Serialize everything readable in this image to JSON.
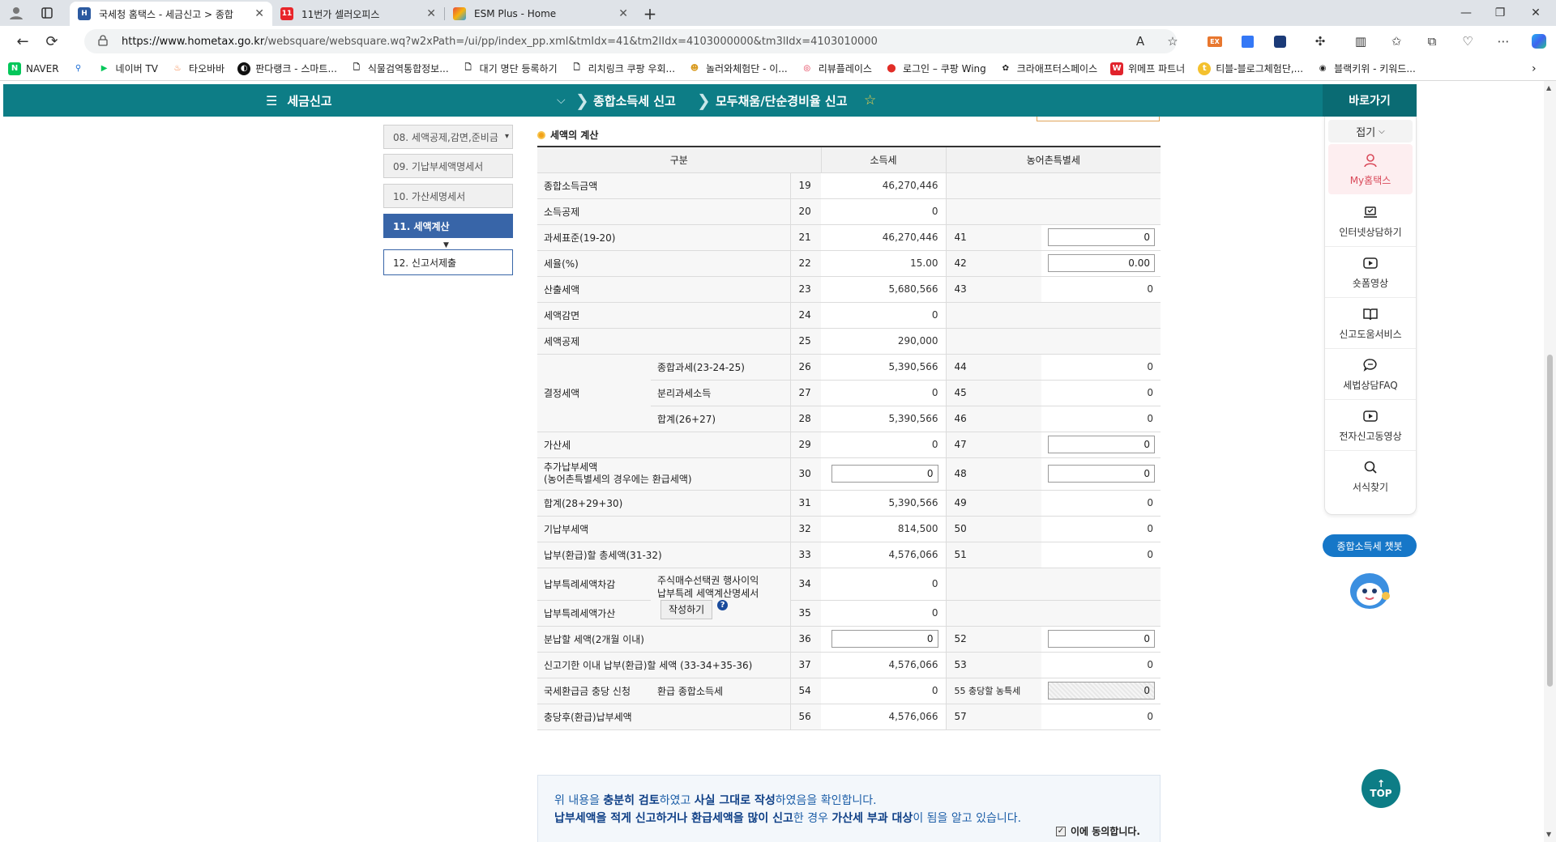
{
  "browser": {
    "tabs": [
      {
        "title": "국세청 홈택스 - 세금신고 > 종합",
        "active": true
      },
      {
        "title": "11번가 셀러오피스",
        "active": false
      },
      {
        "title": "ESM Plus - Home",
        "active": false
      }
    ],
    "url_host": "https://www.hometax.go.kr",
    "url_path": "/websquare/websquare.wq?w2xPath=/ui/pp/index_pp.xml&tmIdx=41&tm2lIdx=4103000000&tm3lIdx=4103010000",
    "bookmarks": [
      "NAVER",
      "네이버 TV",
      "타오바바",
      "판다랭크 - 스마트...",
      "식물검역통합정보...",
      "대기 명단 등록하기",
      "리치링크 쿠팡 우회...",
      "놀러와체험단 - 이...",
      "리뷰플레이스",
      "로그인 – 쿠팡 Wing",
      "크라애프터스페이스",
      "위메프 파트너",
      "티블-블로그체험단,...",
      "블랙키위 - 키워드..."
    ]
  },
  "nav": {
    "menu_label": "세금신고",
    "crumb1": "종합소득세 신고",
    "crumb2": "모두채움/단순경비율 신고",
    "shortcut_title": "바로가기"
  },
  "quick": {
    "fold": "접기",
    "items": [
      "My홈택스",
      "인터넷상담하기",
      "숏폼영상",
      "신고도움서비스",
      "세법상담FAQ",
      "전자신고동영상",
      "서식찾기"
    ],
    "chatbot": "종합소득세 챗봇",
    "top": "TOP"
  },
  "steps": [
    {
      "label": "08. 세액공제,감면,준비금"
    },
    {
      "label": "09. 기납부세액명세서"
    },
    {
      "label": "10. 가산세명세서"
    },
    {
      "label": "11. 세액계산"
    },
    {
      "label": "12. 신고서제출"
    }
  ],
  "section_title": "세액의 계산",
  "table": {
    "headers": [
      "구분",
      "소득세",
      "농어촌특별세"
    ],
    "rows": {
      "r19": {
        "label": "종합소득금액",
        "no": "19",
        "val": "46,270,446"
      },
      "r20": {
        "label": "소득공제",
        "no": "20",
        "val": "0"
      },
      "r21": {
        "label": "과세표준(19-20)",
        "no": "21",
        "val": "46,270,446",
        "no2": "41",
        "val2": "0"
      },
      "r22": {
        "label": "세율(%)",
        "no": "22",
        "val": "15.00",
        "no2": "42",
        "val2": "0.00"
      },
      "r23": {
        "label": "산출세액",
        "no": "23",
        "val": "5,680,566",
        "no2": "43",
        "val2": "0"
      },
      "r24": {
        "label": "세액감면",
        "no": "24",
        "val": "0"
      },
      "r25": {
        "label": "세액공제",
        "no": "25",
        "val": "290,000"
      },
      "group_label": "결정세액",
      "r26": {
        "label": "종합과세(23-24-25)",
        "no": "26",
        "val": "5,390,566",
        "no2": "44",
        "val2": "0"
      },
      "r27": {
        "label": "분리과세소득",
        "no": "27",
        "val": "0",
        "no2": "45",
        "val2": "0"
      },
      "r28": {
        "label": "합계(26+27)",
        "no": "28",
        "val": "5,390,566",
        "no2": "46",
        "val2": "0"
      },
      "r29": {
        "label": "가산세",
        "no": "29",
        "val": "0",
        "no2": "47",
        "val2": "0"
      },
      "r30": {
        "label": "추가납부세액",
        "label2": "(농어촌특별세의 경우에는 환급세액)",
        "no": "30",
        "val": "0",
        "no2": "48",
        "val2": "0"
      },
      "r31": {
        "label": "합계(28+29+30)",
        "no": "31",
        "val": "5,390,566",
        "no2": "49",
        "val2": "0"
      },
      "r32": {
        "label": "기납부세액",
        "no": "32",
        "val": "814,500",
        "no2": "50",
        "val2": "0"
      },
      "r33": {
        "label": "납부(환급)할 총세액(31-32)",
        "no": "33",
        "val": "4,576,066",
        "no2": "51",
        "val2": "0"
      },
      "r34": {
        "label": "납부특례세액차감",
        "no": "34",
        "val": "0"
      },
      "r35": {
        "label": "납부특례세액가산",
        "no": "35",
        "val": "0"
      },
      "stock_note1": "주식매수선택권 행사이익",
      "stock_note2": "납부특례 세액계산명세서",
      "write_btn": "작성하기",
      "help": "?",
      "r36": {
        "label": "분납할 세액(2개월 이내)",
        "no": "36",
        "val": "0",
        "no2": "52",
        "val2": "0"
      },
      "r37": {
        "label": "신고기한 이내 납부(환급)할 세액 (33-34+35-36)",
        "no": "37",
        "val": "4,576,066",
        "no2": "53",
        "val2": "0"
      },
      "r54": {
        "label": "국세환급금 충당 신청",
        "sub": "환급 종합소득세",
        "no": "54",
        "val": "0",
        "no2": "55 충당할 농특세",
        "val2": "0"
      },
      "r56": {
        "label": "충당후(환급)납부세액",
        "no": "56",
        "val": "4,576,066",
        "no2": "57",
        "val2": "0"
      }
    }
  },
  "confirm": {
    "line1_a": "위 내용을 ",
    "line1_b": "충분히 검토",
    "line1_c": "하였고 ",
    "line1_d": "사실 그대로 작성",
    "line1_e": "하였음을 확인합니다.",
    "line2_a": "납부세액을 적게 신고하거나 환급세액을 많이 신고",
    "line2_b": "한 경우 ",
    "line2_c": "가산세 부과 대상",
    "line2_d": "이 됨을 알고 있습니다.",
    "agree": "이에 동의합니다."
  }
}
